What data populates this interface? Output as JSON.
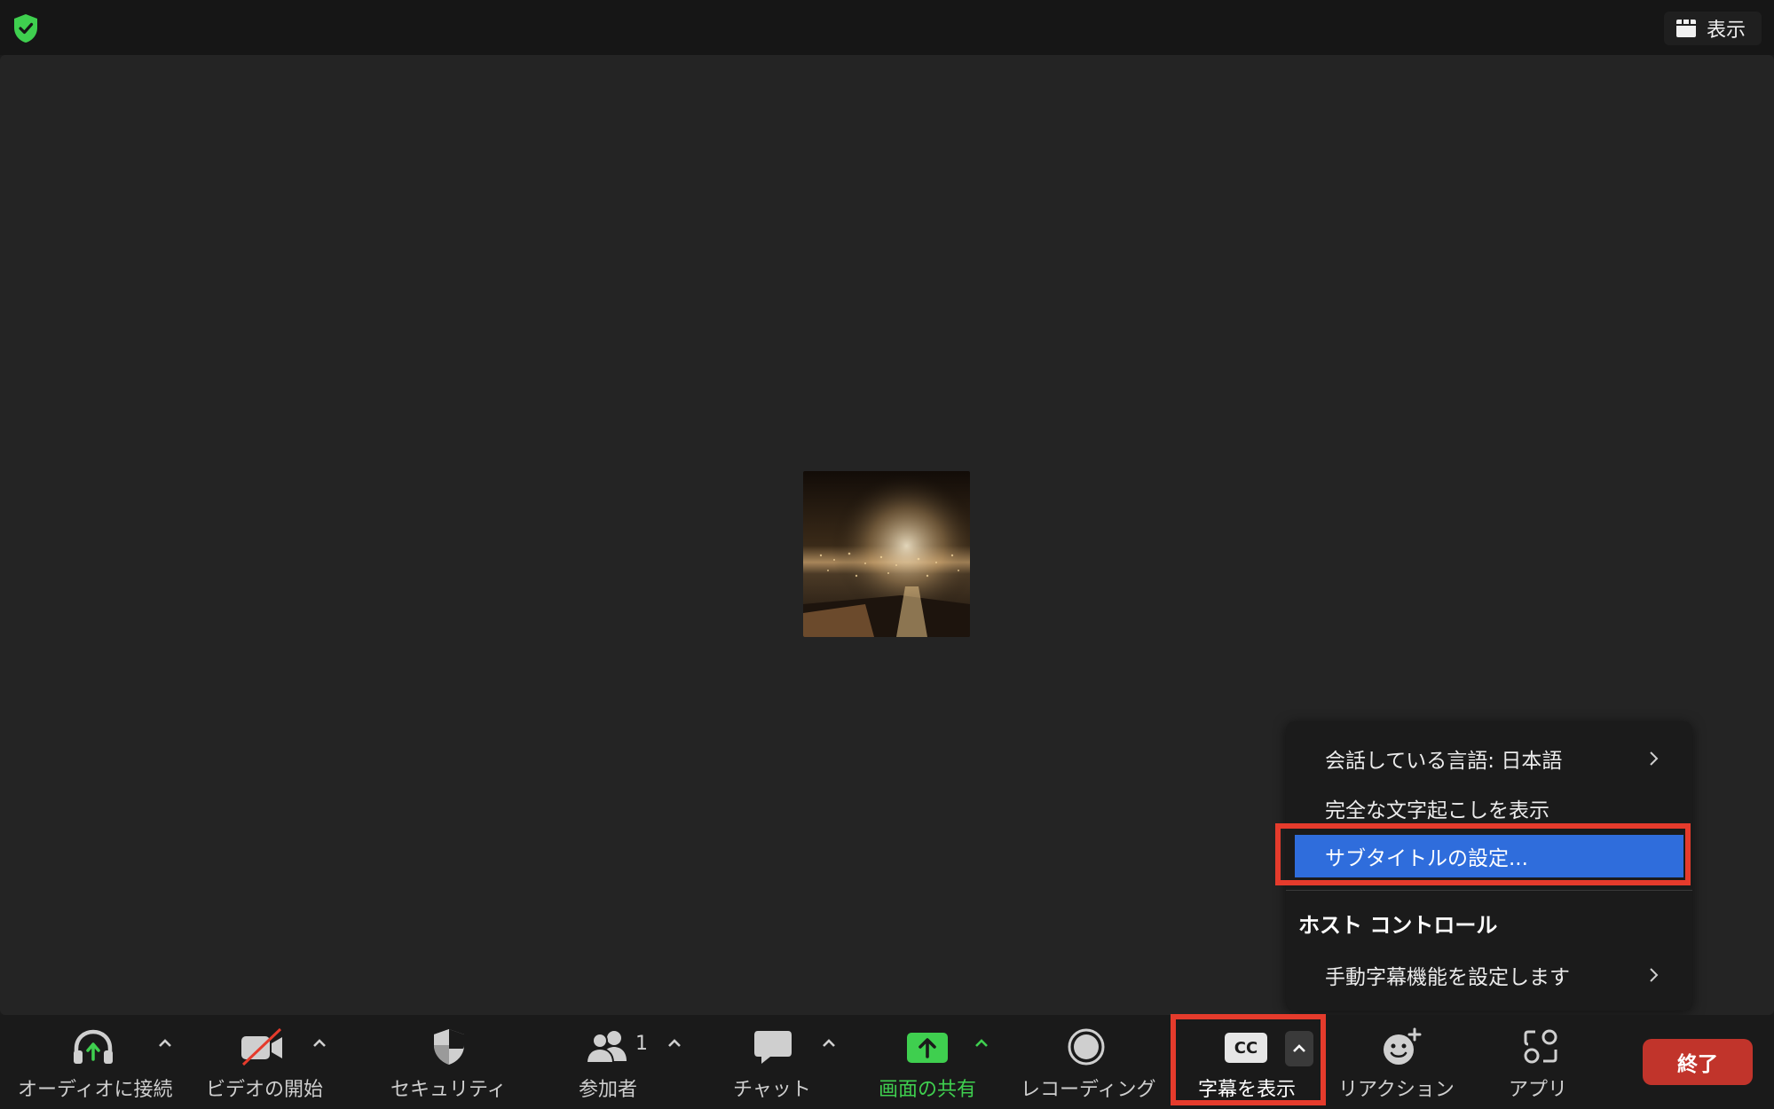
{
  "header": {
    "view_label": "表示"
  },
  "captions_menu": {
    "items": [
      {
        "label": "会話している言語: 日本語",
        "has_submenu": true
      },
      {
        "label": "完全な文字起こしを表示",
        "has_submenu": false
      },
      {
        "label": "サブタイトルの設定...",
        "has_submenu": false,
        "highlighted": true
      }
    ],
    "host_section_title": "ホスト コントロール",
    "host_items": [
      {
        "label": "手動字幕機能を設定します",
        "has_submenu": true
      }
    ]
  },
  "toolbar": {
    "audio_label": "オーディオに接続",
    "video_label": "ビデオの開始",
    "security_label": "セキュリティ",
    "participants_label": "参加者",
    "participants_count": "1",
    "chat_label": "チャット",
    "share_label": "画面の共有",
    "record_label": "レコーディング",
    "captions_label": "字幕を表示",
    "cc_text": "CC",
    "reactions_label": "リアクション",
    "apps_label": "アプリ",
    "end_label": "終了"
  },
  "colors": {
    "accent_green": "#3fcf4f",
    "highlight_blue": "#2f6ddc",
    "annotation_red": "#e53b2c",
    "end_red": "#c1342b"
  }
}
